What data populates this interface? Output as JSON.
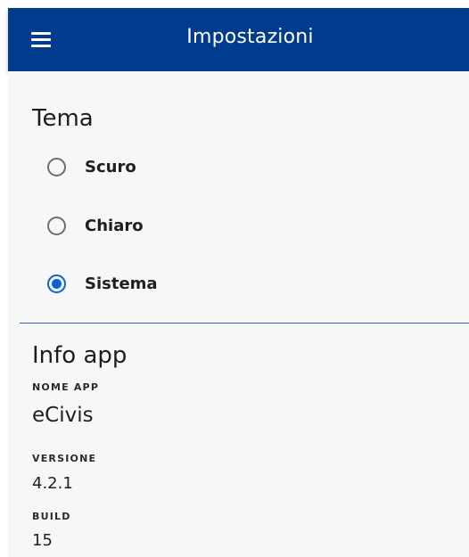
{
  "appbar": {
    "title": "Impostazioni",
    "menu_icon": "hamburger-menu-icon",
    "background": "#003b8e"
  },
  "theme_section": {
    "title": "Tema",
    "options": [
      {
        "label": "Scuro",
        "selected": false
      },
      {
        "label": "Chiaro",
        "selected": false
      },
      {
        "label": "Sistema",
        "selected": true
      }
    ],
    "accent": "#0b63d6"
  },
  "info_section": {
    "title": "Info app",
    "app_name_label": "NOME APP",
    "app_name_value": "eCivis",
    "version_label": "VERSIONE",
    "version_value": "4.2.1",
    "build_label": "BUILD",
    "build_value": "15"
  }
}
